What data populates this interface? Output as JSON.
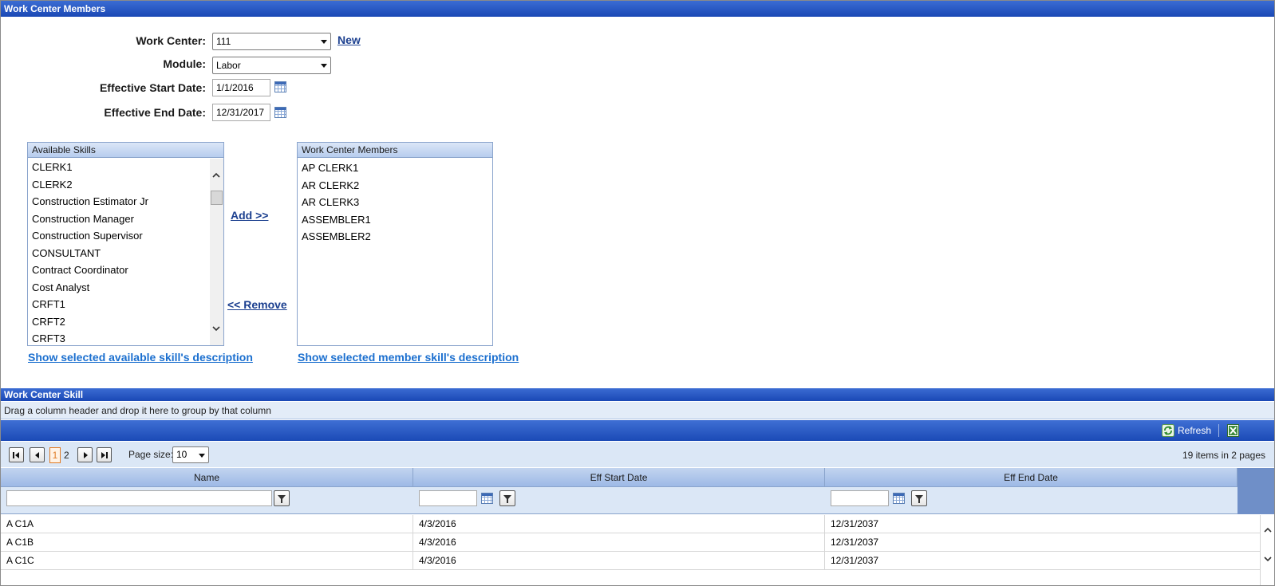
{
  "window": {
    "title": "Work Center Members"
  },
  "form": {
    "work_center_label": "Work Center:",
    "work_center_value": "111",
    "new_link": "New",
    "module_label": "Module:",
    "module_value": "Labor",
    "start_date_label": "Effective Start Date:",
    "start_date_value": "1/1/2016",
    "end_date_label": "Effective End Date:",
    "end_date_value": "12/31/2017"
  },
  "available": {
    "header": "Available Skills",
    "items": [
      "CLERK1",
      "CLERK2",
      "Construction Estimator Jr",
      "Construction Manager",
      "Construction Supervisor",
      "CONSULTANT",
      "Contract Coordinator",
      "Cost Analyst",
      "CRFT1",
      "CRFT2",
      "CRFT3"
    ],
    "show_desc": "Show selected available skill's description"
  },
  "actions": {
    "add": "Add >>",
    "remove": "<< Remove"
  },
  "members": {
    "header": "Work Center Members",
    "items": [
      "AP CLERK1",
      "AR CLERK2",
      "AR CLERK3",
      "ASSEMBLER1",
      "ASSEMBLER2"
    ],
    "show_desc": "Show selected member skill's description"
  },
  "grid": {
    "section_title": "Work Center Skill",
    "group_hint": "Drag a column header and drop it here to group by that column",
    "refresh_label": "Refresh",
    "pager": {
      "current_page": "1",
      "other_page": "2",
      "page_size_label": "Page size:",
      "page_size": "10",
      "summary": "19 items in 2 pages"
    },
    "columns": [
      "Name",
      "Eff Start Date",
      "Eff End Date"
    ],
    "rows": [
      [
        "A C1A",
        "4/3/2016",
        "12/31/2037"
      ],
      [
        "A C1B",
        "4/3/2016",
        "12/31/2037"
      ],
      [
        "A C1C",
        "4/3/2016",
        "12/31/2037"
      ]
    ]
  },
  "icons": [
    "calendar-icon",
    "refresh-icon",
    "export-excel-icon",
    "filter-icon",
    "chevron-up-icon",
    "chevron-down-icon"
  ]
}
